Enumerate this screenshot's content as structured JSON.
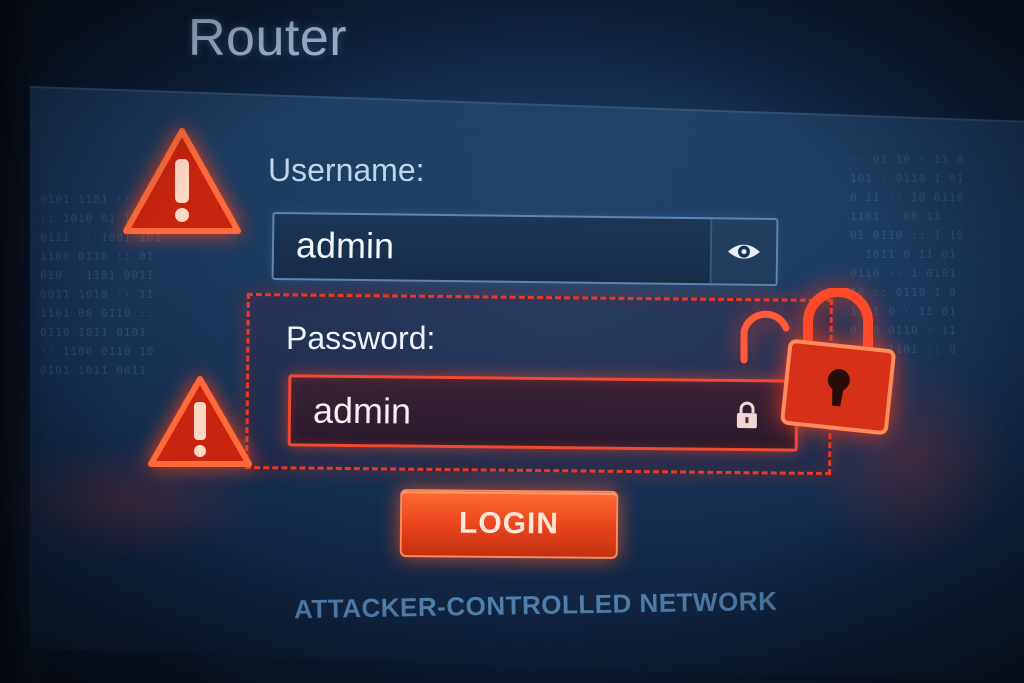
{
  "window": {
    "title": "Router"
  },
  "form": {
    "username": {
      "label": "Username:",
      "value": "admin",
      "toggle_icon": "eye-icon"
    },
    "password": {
      "label": "Password:",
      "value": "admin",
      "field_icon": "lock-icon"
    },
    "login_label": "LOGIN"
  },
  "status": {
    "footer_text": "ATTACKER-CONTROLLED NETWORK"
  },
  "alerts": {
    "username_warning_icon": "warning-triangle-icon",
    "password_warning_icon": "warning-triangle-icon",
    "overlay_icon": "unlocked-padlock-icon"
  },
  "colors": {
    "accent_danger": "#e83a2a",
    "login_button": "#e8431c",
    "title_text": "#a9c4df",
    "footer_text": "#4f7fad",
    "background": "#173154"
  }
}
